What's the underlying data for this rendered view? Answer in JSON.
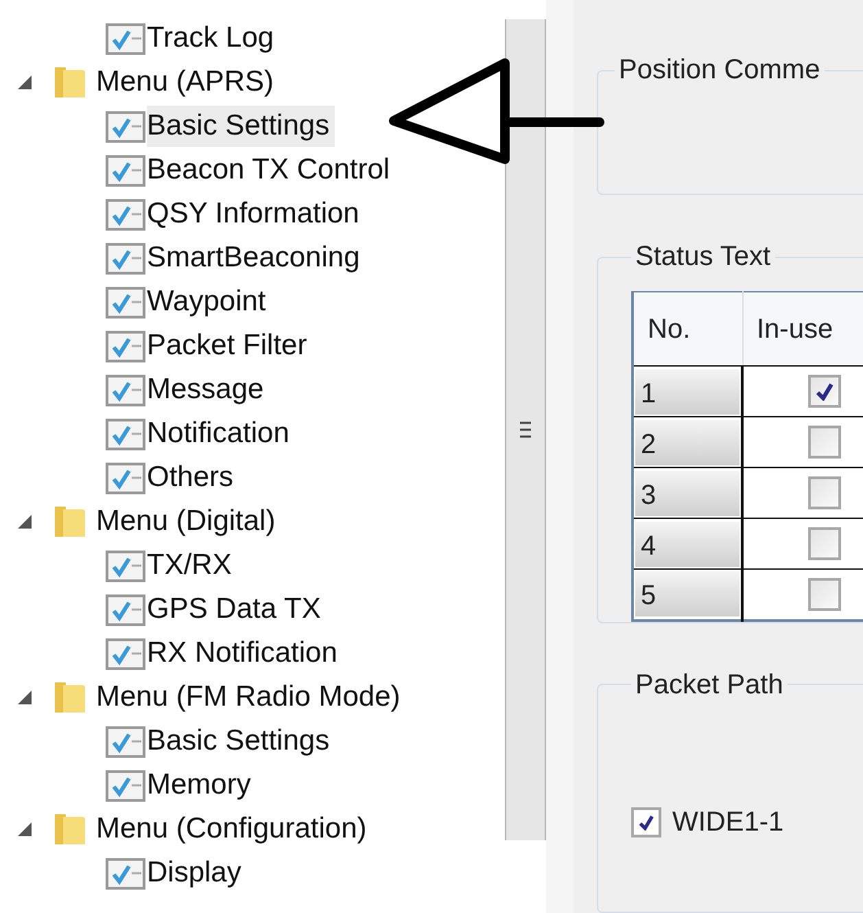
{
  "tree": [
    {
      "label": "Track Log",
      "kind": "item",
      "checked": true,
      "selected": false
    },
    {
      "label": "Menu (APRS)",
      "kind": "folder",
      "expanded": true,
      "children": [
        {
          "label": "Basic Settings",
          "checked": true,
          "selected": true
        },
        {
          "label": "Beacon TX Control",
          "checked": true,
          "selected": false
        },
        {
          "label": "QSY Information",
          "checked": true,
          "selected": false
        },
        {
          "label": "SmartBeaconing",
          "checked": true,
          "selected": false
        },
        {
          "label": "Waypoint",
          "checked": true,
          "selected": false
        },
        {
          "label": "Packet Filter",
          "checked": true,
          "selected": false
        },
        {
          "label": "Message",
          "checked": true,
          "selected": false
        },
        {
          "label": "Notification",
          "checked": true,
          "selected": false
        },
        {
          "label": "Others",
          "checked": true,
          "selected": false
        }
      ]
    },
    {
      "label": "Menu (Digital)",
      "kind": "folder",
      "expanded": true,
      "children": [
        {
          "label": "TX/RX",
          "checked": true,
          "selected": false
        },
        {
          "label": "GPS Data TX",
          "checked": true,
          "selected": false
        },
        {
          "label": "RX Notification",
          "checked": true,
          "selected": false
        }
      ]
    },
    {
      "label": "Menu (FM Radio Mode)",
      "kind": "folder",
      "expanded": true,
      "children": [
        {
          "label": "Basic Settings",
          "checked": true,
          "selected": false
        },
        {
          "label": "Memory",
          "checked": true,
          "selected": false
        }
      ]
    },
    {
      "label": "Menu (Configuration)",
      "kind": "folder",
      "expanded": true,
      "children": [
        {
          "label": "Display",
          "checked": true,
          "selected": false
        }
      ]
    }
  ],
  "position_comment": {
    "title": "Position Comme"
  },
  "status_text": {
    "title": "Status Text",
    "columns": [
      "No.",
      "In-use"
    ],
    "rows": [
      {
        "no": "1",
        "in_use": true
      },
      {
        "no": "2",
        "in_use": false
      },
      {
        "no": "3",
        "in_use": false
      },
      {
        "no": "4",
        "in_use": false
      },
      {
        "no": "5",
        "in_use": false
      }
    ]
  },
  "packet_path": {
    "title": "Packet Path",
    "options": [
      {
        "label": "WIDE1-1",
        "checked": true
      }
    ]
  }
}
